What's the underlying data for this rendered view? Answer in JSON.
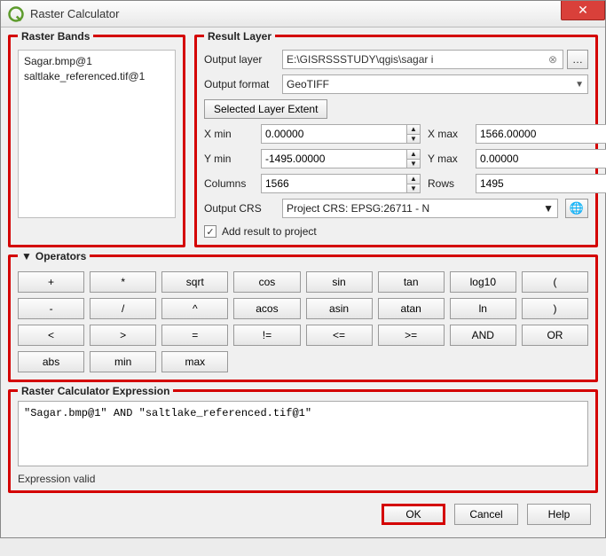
{
  "window": {
    "title": "Raster Calculator"
  },
  "bands": {
    "title": "Raster Bands",
    "items": [
      "Sagar.bmp@1",
      "saltlake_referenced.tif@1"
    ]
  },
  "result": {
    "title": "Result Layer",
    "output_layer_label": "Output layer",
    "output_layer_value": "E:\\GISRSSSTUDY\\qgis\\sagar i",
    "output_format_label": "Output format",
    "output_format_value": "GeoTIFF",
    "selected_extent_label": "Selected Layer Extent",
    "xmin_label": "X min",
    "xmin": "0.00000",
    "xmax_label": "X max",
    "xmax": "1566.00000",
    "ymin_label": "Y min",
    "ymin": "-1495.00000",
    "ymax_label": "Y max",
    "ymax": "0.00000",
    "cols_label": "Columns",
    "cols": "1566",
    "rows_label": "Rows",
    "rows": "1495",
    "crs_label": "Output CRS",
    "crs_value": "Project CRS: EPSG:26711 - N",
    "add_result_label": "Add result to project",
    "add_result_checked": true,
    "browse_label": "…"
  },
  "operators": {
    "title": "Operators",
    "row1": [
      "+",
      "*",
      "sqrt",
      "cos",
      "sin",
      "tan",
      "log10",
      "("
    ],
    "row2": [
      "-",
      "/",
      "^",
      "acos",
      "asin",
      "atan",
      "ln",
      ")"
    ],
    "row3": [
      "<",
      ">",
      "=",
      "!=",
      "<=",
      ">=",
      "AND",
      "OR"
    ],
    "row4": [
      "abs",
      "min",
      "max"
    ]
  },
  "expression": {
    "title": "Raster Calculator Expression",
    "value": "\"Sagar.bmp@1\" AND \"saltlake_referenced.tif@1\"",
    "status": "Expression valid"
  },
  "footer": {
    "ok": "OK",
    "cancel": "Cancel",
    "help": "Help"
  }
}
